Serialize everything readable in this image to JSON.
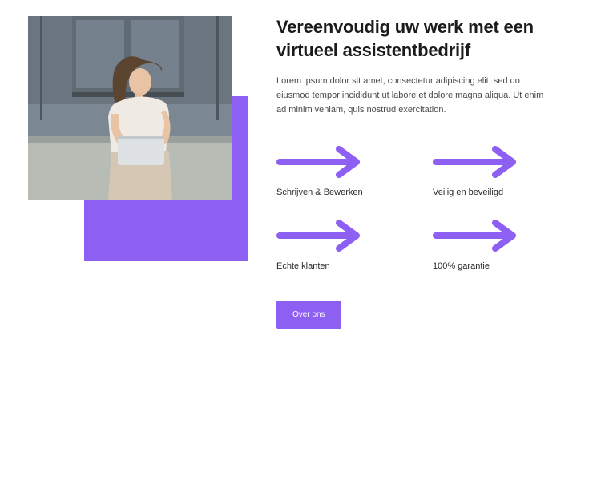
{
  "colors": {
    "accent": "#8d5ff3"
  },
  "hero": {
    "image_alt": "Vrouw met laptop voor een glazen gebouw"
  },
  "content": {
    "heading": "Vereenvoudig uw werk met een virtueel assistentbedrijf",
    "body": "Lorem ipsum dolor sit amet, consectetur adipiscing elit, sed do eiusmod tempor incididunt ut labore et dolore magna aliqua. Ut enim ad minim veniam, quis nostrud exercitation."
  },
  "features": [
    {
      "label": "Schrijven & Bewerken",
      "icon": "arrow-right-icon"
    },
    {
      "label": "Veilig en beveiligd",
      "icon": "arrow-right-icon"
    },
    {
      "label": "Echte klanten",
      "icon": "arrow-right-icon"
    },
    {
      "label": "100% garantie",
      "icon": "arrow-right-icon"
    }
  ],
  "cta": {
    "label": "Over ons"
  }
}
